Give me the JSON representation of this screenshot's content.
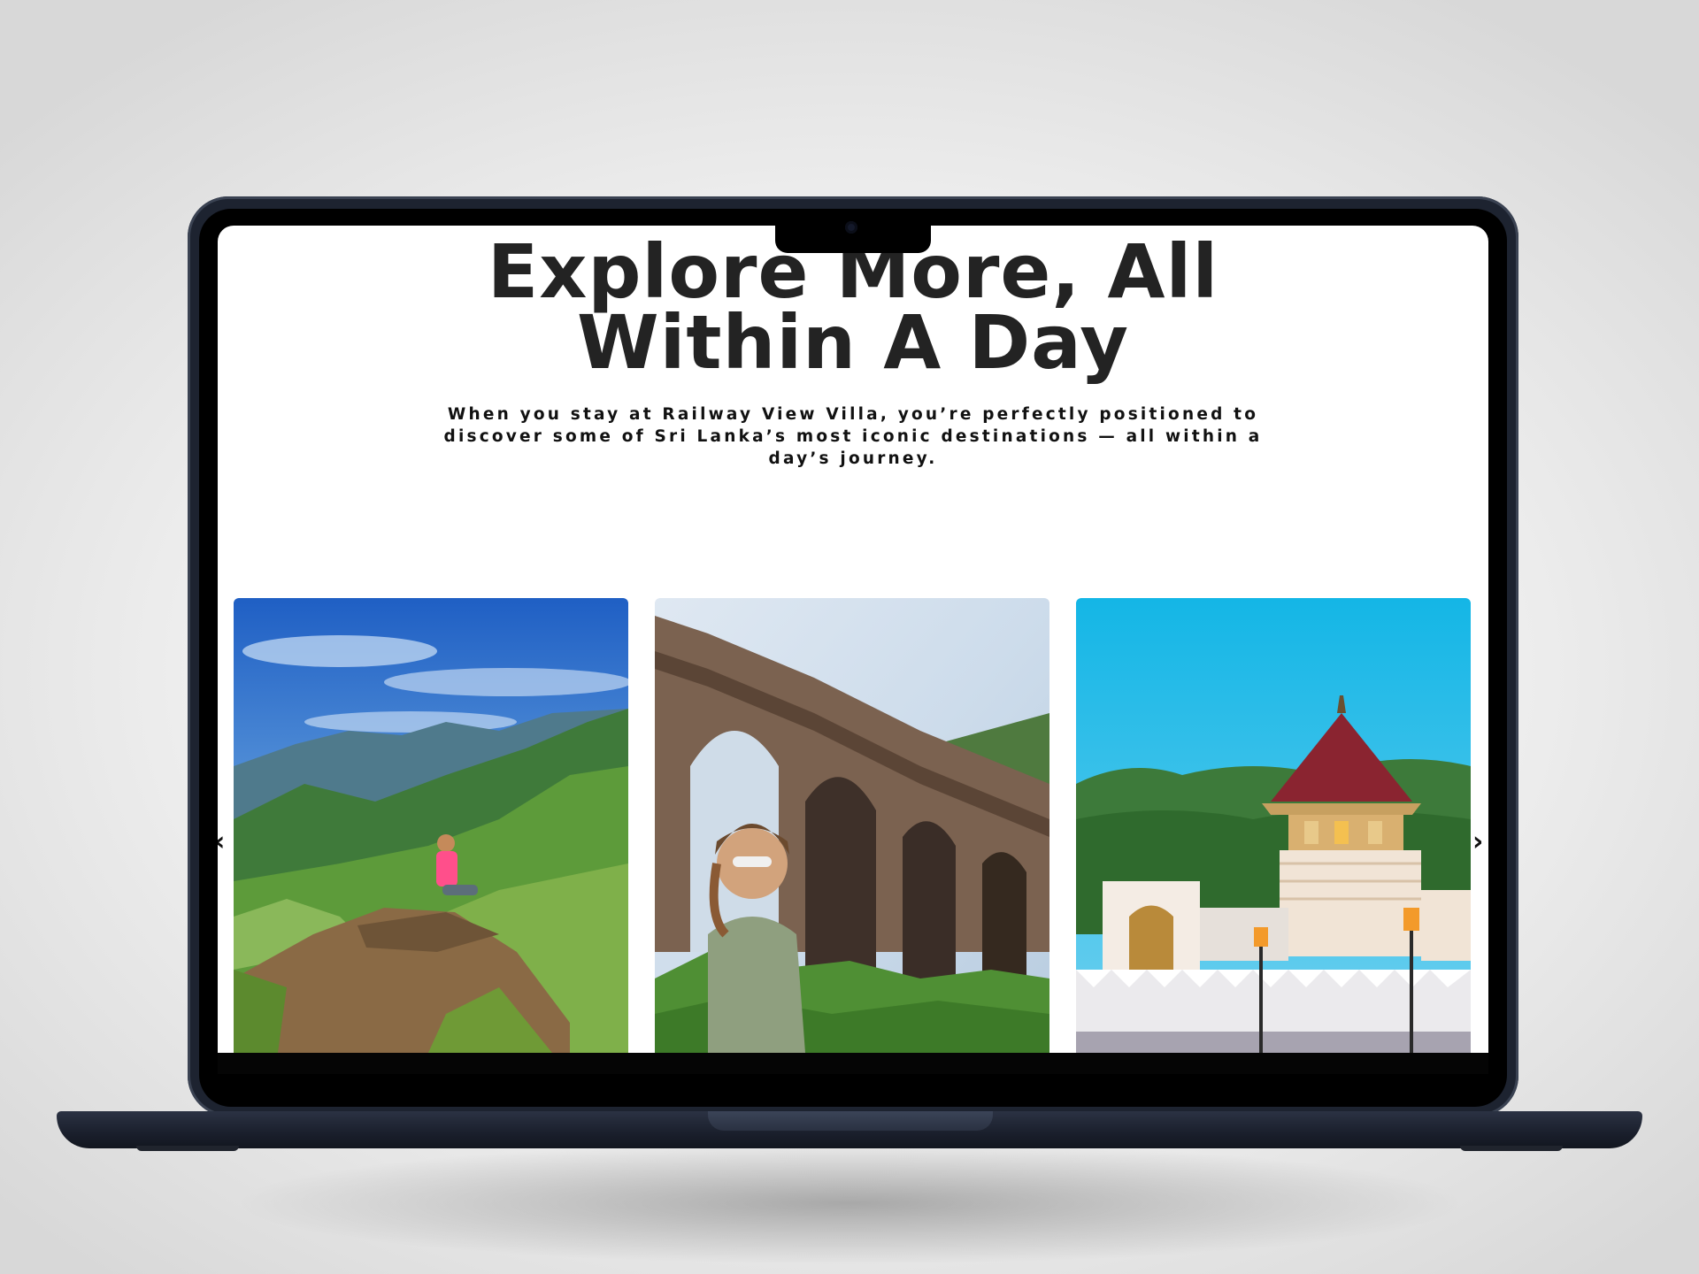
{
  "page": {
    "heading_line1": "Explore More, All",
    "heading_line2": "Within A Day",
    "description": "When you stay at Railway View Villa, you’re perfectly positioned to discover some of Sri Lanka’s most iconic destinations — all within a day’s journey."
  },
  "carousel": {
    "prev_icon": "‹",
    "next_icon": "›",
    "cards": [
      {
        "icon": "mountain-view-photo"
      },
      {
        "icon": "nine-arch-bridge-photo"
      },
      {
        "icon": "temple-photo"
      }
    ]
  },
  "colors": {
    "heading": "#232323",
    "laptop_body": "#1d2330"
  }
}
